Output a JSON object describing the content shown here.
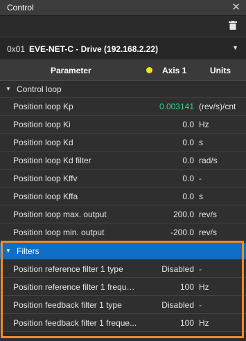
{
  "window": {
    "title": "Control"
  },
  "device": {
    "address": "0x01",
    "name": "EVE-NET-C - Drive (192.168.2.22)"
  },
  "table": {
    "header": {
      "parameter": "Parameter",
      "axis": "Axis 1",
      "units": "Units"
    }
  },
  "colors": {
    "axis_dot": "#f2e41f",
    "accent_value": "#3bd18a",
    "selected_group": "#0f6fc6",
    "highlight_border": "#f08b2a"
  },
  "groups": {
    "control_loop": {
      "label": "Control loop",
      "rows": [
        {
          "name": "Position loop Kp",
          "value": "0.003141",
          "unit": "(rev/s)/cnt"
        },
        {
          "name": "Position loop Ki",
          "value": "0.0",
          "unit": "Hz"
        },
        {
          "name": "Position loop Kd",
          "value": "0.0",
          "unit": "s"
        },
        {
          "name": "Position loop Kd filter",
          "value": "0.0",
          "unit": "rad/s"
        },
        {
          "name": "Position loop Kffv",
          "value": "0.0",
          "unit": "-"
        },
        {
          "name": "Position loop Kffa",
          "value": "0.0",
          "unit": "s"
        },
        {
          "name": "Position loop max. output",
          "value": "200.0",
          "unit": "rev/s"
        },
        {
          "name": "Position loop min. output",
          "value": "-200.0",
          "unit": "rev/s"
        }
      ]
    },
    "filters": {
      "label": "Filters",
      "rows": [
        {
          "name": "Position reference filter 1 type",
          "value": "Disabled",
          "unit": "-"
        },
        {
          "name": "Position reference filter 1 freque...",
          "value": "100",
          "unit": "Hz"
        },
        {
          "name": "Position feedback filter 1 type",
          "value": "Disabled",
          "unit": "-"
        },
        {
          "name": "Position feedback filter 1 freque...",
          "value": "100",
          "unit": "Hz"
        }
      ]
    }
  }
}
